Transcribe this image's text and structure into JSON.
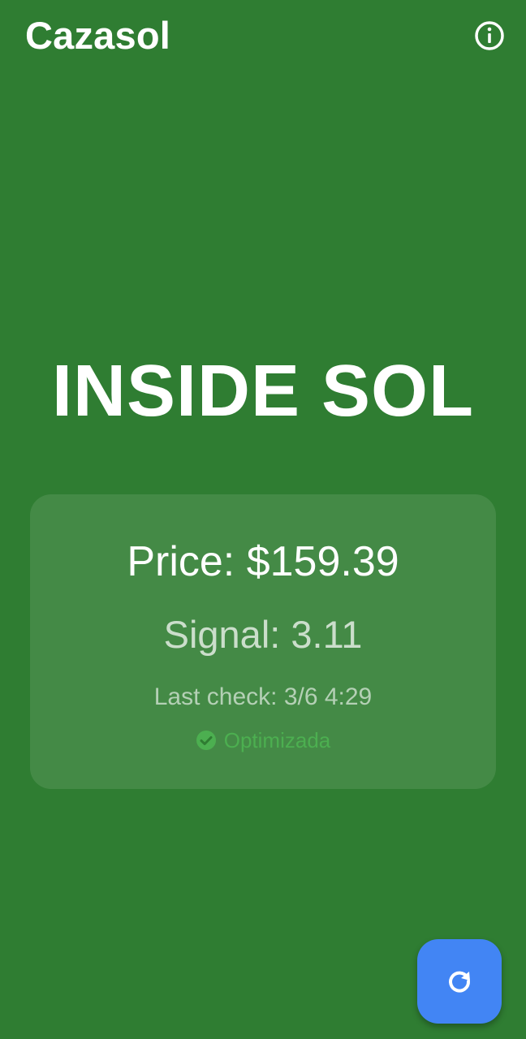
{
  "app_bar": {
    "title": "Cazasol",
    "info_icon": "info-circle-icon"
  },
  "status": {
    "heading": "INSIDE SOL"
  },
  "card": {
    "price": "Price: $159.39",
    "signal": "Signal: 3.11",
    "last_check": "Last check: 3/6 4:29",
    "optimized_label": "Optimizada",
    "optimized_icon": "check-circle-icon"
  },
  "fab": {
    "icon": "refresh-icon"
  },
  "colors": {
    "background": "#2f7d32",
    "optimized_green": "#4caf50",
    "fab_blue": "#4285f4"
  }
}
